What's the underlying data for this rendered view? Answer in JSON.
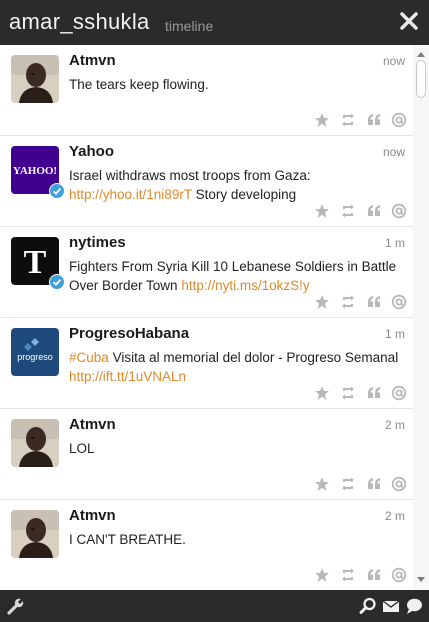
{
  "header": {
    "username": "amar_sshukla",
    "view": "timeline"
  },
  "tweets": [
    {
      "author": "Atmvn",
      "time": "now",
      "text": "The tears keep flowing.",
      "avatar": "person-photo",
      "verified": false
    },
    {
      "author": "Yahoo",
      "time": "now",
      "text": "Israel withdraws most troops from Gaza:",
      "link": "http://yhoo.it/1ni89rT",
      "text_after": "Story developing",
      "avatar": "yahoo-logo",
      "avatar_label": "YAHOO!",
      "verified": true
    },
    {
      "author": "nytimes",
      "time": "1 m",
      "text": "Fighters From Syria Kill 10 Lebanese Soldiers in Battle Over Border Town",
      "link": "http://nyti.ms/1okzS!y",
      "avatar": "nyt-logo",
      "avatar_label": "T",
      "verified": true
    },
    {
      "author": "ProgresoHabana",
      "time": "1 m",
      "hashtag": "#Cuba",
      "text": "Visita al memorial del dolor - Progreso Semanal",
      "link": "http://ift.tt/1uVNALn",
      "avatar": "progreso-logo",
      "avatar_label": "progreso",
      "verified": false
    },
    {
      "author": "Atmvn",
      "time": "2 m",
      "text": "LOL",
      "avatar": "person-photo",
      "verified": false
    },
    {
      "author": "Atmvn",
      "time": "2 m",
      "text": "I CAN'T BREATHE.",
      "avatar": "person-photo",
      "verified": false
    }
  ],
  "tweet_actions": [
    "favorite-icon",
    "retweet-icon",
    "quote-icon",
    "reply-icon"
  ],
  "bottom_bar": {
    "left": [
      "settings-wrench-icon"
    ],
    "right": [
      "search-icon",
      "mail-icon",
      "chat-bubble-icon"
    ]
  },
  "colors": {
    "titlebar": "#2b2b2b",
    "link": "#e0892a",
    "action_icon": "#b8b8b8",
    "verified": "#3ea1de"
  }
}
